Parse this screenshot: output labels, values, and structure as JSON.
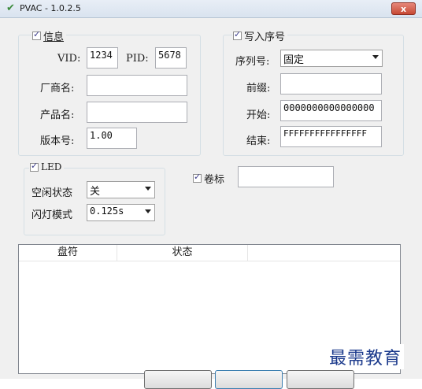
{
  "window": {
    "title": "PVAC - 1.0.2.5",
    "close": "x"
  },
  "info": {
    "legend": "信息",
    "vid_label": "VID:",
    "vid": "1234",
    "pid_label": "PID:",
    "pid": "5678",
    "vendor_label": "厂商名:",
    "vendor": "",
    "product_label": "产品名:",
    "product": "",
    "version_label": "版本号:",
    "version": "1.00"
  },
  "serial": {
    "legend": "写入序号",
    "type_label": "序列号:",
    "type": "固定",
    "prefix_label": "前缀:",
    "prefix": "",
    "start_label": "开始:",
    "start": "0000000000000000",
    "end_label": "结束:",
    "end": "FFFFFFFFFFFFFFFF"
  },
  "led": {
    "legend": "LED",
    "idle_label": "空闲状态",
    "idle": "关",
    "blink_label": "闪灯模式",
    "blink": "0.125s"
  },
  "volume": {
    "label": "卷标",
    "value": ""
  },
  "table": {
    "columns": [
      "盘符",
      "状态"
    ]
  },
  "buttons": [
    "",
    "",
    ""
  ],
  "watermark": "最需教育"
}
